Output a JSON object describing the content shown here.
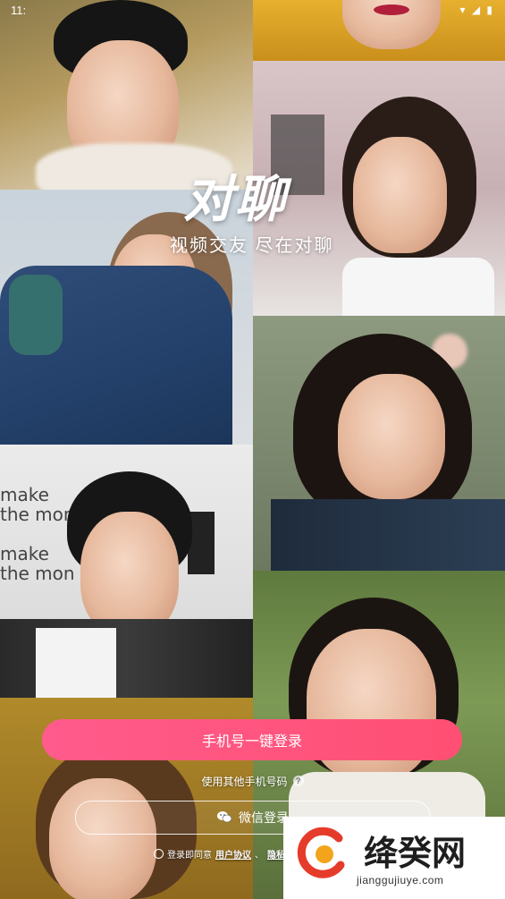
{
  "status_bar": {
    "time": "11:",
    "icons": "▾ ◢ ▮"
  },
  "app": {
    "title": "对聊",
    "tagline": "视频交友  尽在对聊"
  },
  "login": {
    "phone_button": "手机号一键登录",
    "other_phone": "使用其他手机号码",
    "help_icon": "?",
    "wechat_button": "微信登录",
    "agreement_prefix": "登录即同意",
    "user_agreement": "用户协议",
    "privacy_agreement": "隐私协",
    "separator": "、"
  },
  "watermark": {
    "name": "绛癸网",
    "url": "jianggujiuye.com"
  },
  "icons": {
    "wechat": "wechat-icon",
    "help": "question-circle-icon",
    "radio": "radio-unchecked-icon"
  }
}
